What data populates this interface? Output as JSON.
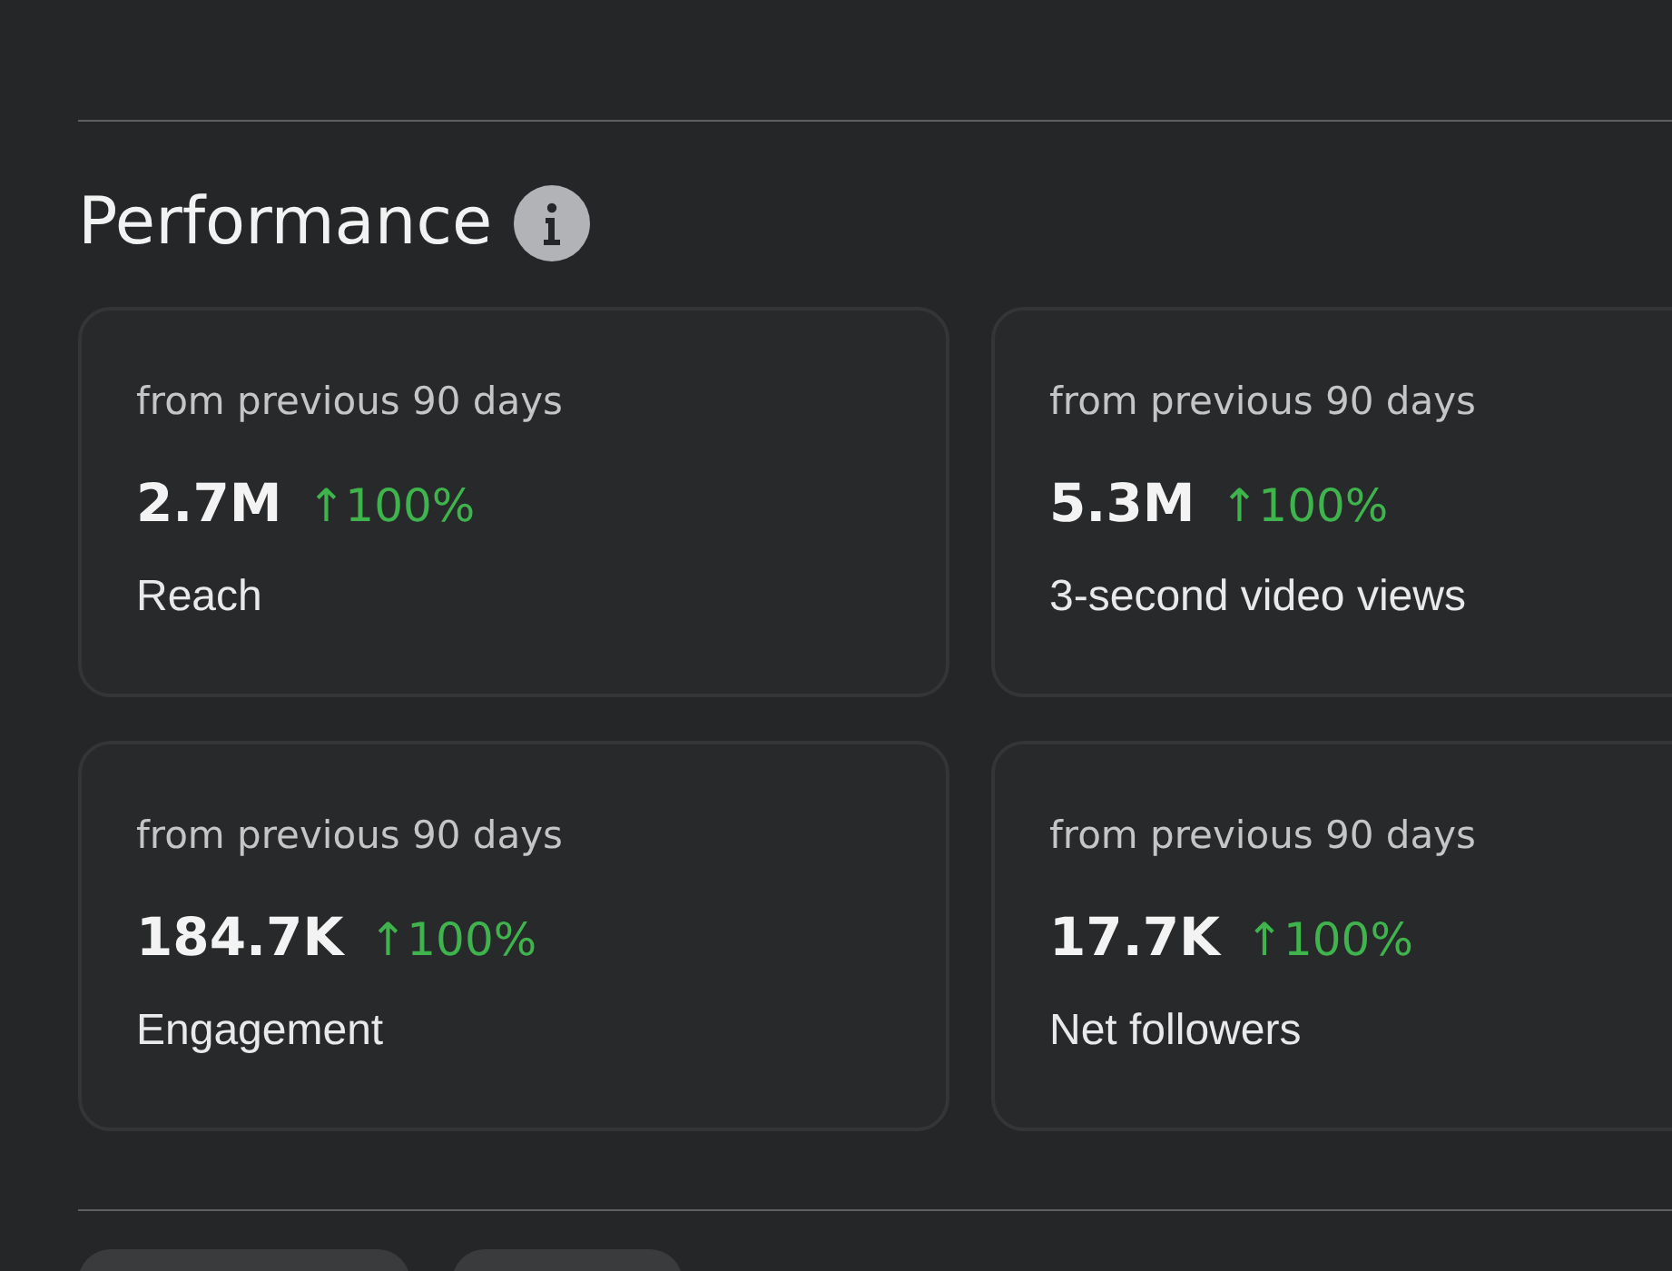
{
  "section": {
    "title": "Performance"
  },
  "metrics": [
    {
      "period": "from previous 90 days",
      "value": "2.7M",
      "change": "↑100%",
      "label": "Reach"
    },
    {
      "period": "from previous 90 days",
      "value": "5.3M",
      "change": "↑100%",
      "label": "3-second video views"
    },
    {
      "period": "from previous 90 days",
      "value": "184.7K",
      "change": "↑100%",
      "label": "Engagement"
    },
    {
      "period": "from previous 90 days",
      "value": "17.7K",
      "change": "↑100%",
      "label": "Net followers"
    }
  ]
}
